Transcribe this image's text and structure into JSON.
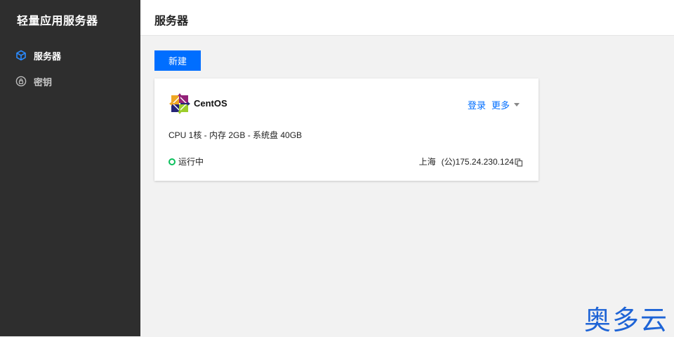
{
  "sidebar": {
    "app_title": "轻量应用服务器",
    "items": [
      {
        "label": "服务器",
        "icon": "cube-icon",
        "active": true
      },
      {
        "label": "密钥",
        "icon": "key-icon",
        "active": false
      }
    ]
  },
  "header": {
    "title": "服务器"
  },
  "toolbar": {
    "new_label": "新建"
  },
  "server_card": {
    "os_icon": "centos-logo",
    "os_name": "CentOS",
    "login_label": "登录",
    "more_label": "更多",
    "spec": "CPU 1核 - 内存 2GB - 系统盘 40GB",
    "status": "运行中",
    "status_color": "#0abf5b",
    "region": "上海",
    "ip": "(公)175.24.230.124"
  },
  "colors": {
    "accent": "#006eff",
    "sidebar_bg": "#2e2e2e"
  },
  "watermark": "奥多云"
}
